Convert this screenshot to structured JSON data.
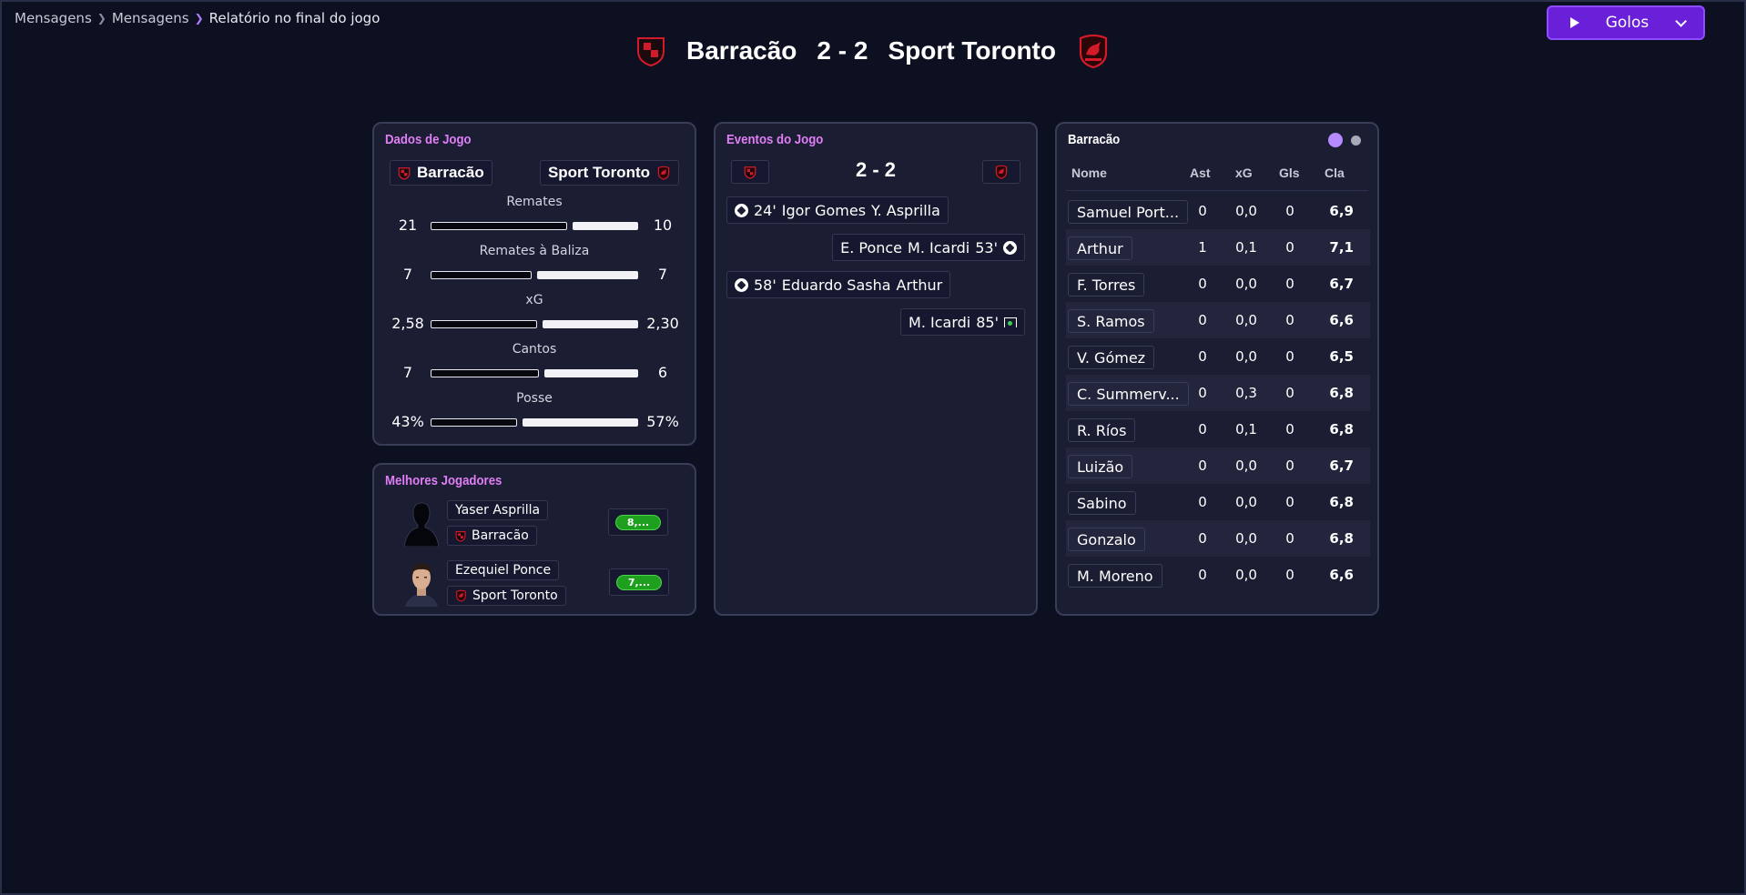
{
  "breadcrumb": {
    "items": [
      "Mensagens",
      "Mensagens"
    ],
    "current": "Relatório no final do jogo"
  },
  "action_button": {
    "label": "Golos"
  },
  "match": {
    "home": "Barracão",
    "away": "Sport Toronto",
    "score": "2 - 2",
    "home_score": "2",
    "away_score": "2"
  },
  "colors": {
    "accent": "#6a1fd8",
    "panel_title": "#e07ef5",
    "rating_green": "#1ea01e",
    "crest_red": "#d21a2a"
  },
  "stats_panel": {
    "title": "Dados de Jogo",
    "home": "Barracão",
    "away": "Sport Toronto",
    "rows": [
      {
        "label": "Remates",
        "home": "21",
        "away": "10",
        "home_share": 0.677
      },
      {
        "label": "Remates à Baliza",
        "home": "7",
        "away": "7",
        "home_share": 0.5
      },
      {
        "label": "xG",
        "home": "2,58",
        "away": "2,30",
        "home_share": 0.529
      },
      {
        "label": "Cantos",
        "home": "7",
        "away": "6",
        "home_share": 0.538
      },
      {
        "label": "Posse",
        "home": "43%",
        "away": "57%",
        "home_share": 0.43
      }
    ]
  },
  "best_players": {
    "title": "Melhores Jogadores",
    "players": [
      {
        "name": "Yaser Asprilla",
        "team": "Barracão",
        "rating": "8,..."
      },
      {
        "name": "Ezequiel Ponce",
        "team": "Sport Toronto",
        "rating": "7,..."
      }
    ]
  },
  "events_panel": {
    "title": "Eventos do Jogo",
    "score": "2 - 2",
    "events": [
      {
        "side": "home",
        "minute": "24'",
        "scorer": "Igor Gomes",
        "assist": "Y. Asprilla",
        "icon": "ball-icon"
      },
      {
        "side": "away",
        "minute": "53'",
        "scorer": "M. Icardi",
        "assist": "E. Ponce",
        "icon": "ball-icon"
      },
      {
        "side": "home",
        "minute": "58'",
        "scorer": "Eduardo Sasha",
        "assist": "Arthur",
        "icon": "ball-icon"
      },
      {
        "side": "away",
        "minute": "85'",
        "scorer": "M. Icardi",
        "assist": "",
        "icon": "penalty-icon"
      }
    ]
  },
  "team_panel": {
    "title": "Barracão",
    "columns": [
      "Nome",
      "Ast",
      "xG",
      "Gls",
      "Cla"
    ],
    "players": [
      {
        "name": "Samuel Port...",
        "ast": "0",
        "xg": "0,0",
        "gls": "0",
        "cla": "6,9"
      },
      {
        "name": "Arthur",
        "ast": "1",
        "xg": "0,1",
        "gls": "0",
        "cla": "7,1"
      },
      {
        "name": "F. Torres",
        "ast": "0",
        "xg": "0,0",
        "gls": "0",
        "cla": "6,7"
      },
      {
        "name": "S. Ramos",
        "ast": "0",
        "xg": "0,0",
        "gls": "0",
        "cla": "6,6"
      },
      {
        "name": "V. Gómez",
        "ast": "0",
        "xg": "0,0",
        "gls": "0",
        "cla": "6,5"
      },
      {
        "name": "C. Summerv...",
        "ast": "0",
        "xg": "0,3",
        "gls": "0",
        "cla": "6,8"
      },
      {
        "name": "R. Ríos",
        "ast": "0",
        "xg": "0,1",
        "gls": "0",
        "cla": "6,8"
      },
      {
        "name": "Luizão",
        "ast": "0",
        "xg": "0,0",
        "gls": "0",
        "cla": "6,7"
      },
      {
        "name": "Sabino",
        "ast": "0",
        "xg": "0,0",
        "gls": "0",
        "cla": "6,8"
      },
      {
        "name": "Gonzalo",
        "ast": "0",
        "xg": "0,0",
        "gls": "0",
        "cla": "6,8"
      },
      {
        "name": "M. Moreno",
        "ast": "0",
        "xg": "0,0",
        "gls": "0",
        "cla": "6,6"
      }
    ]
  }
}
